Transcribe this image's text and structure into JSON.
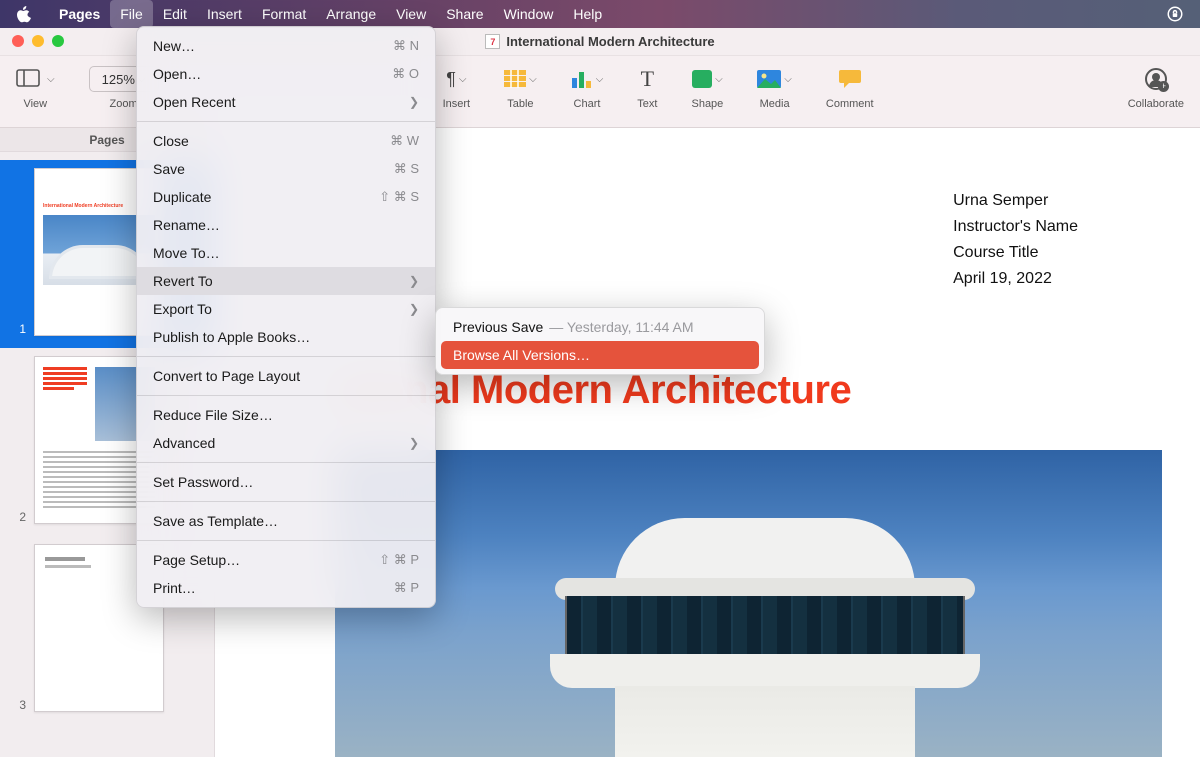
{
  "system_menubar": {
    "app_name": "Pages",
    "items": [
      "File",
      "Edit",
      "Insert",
      "Format",
      "Arrange",
      "View",
      "Share",
      "Window",
      "Help"
    ],
    "active_index": 0
  },
  "window": {
    "document_title": "International Modern Architecture",
    "doc_icon_glyph": "7"
  },
  "toolbar": {
    "view_label": "View",
    "zoom_label": "Zoom",
    "zoom_value": "125%",
    "insert_label": "Insert",
    "table_label": "Table",
    "chart_label": "Chart",
    "text_label": "Text",
    "shape_label": "Shape",
    "media_label": "Media",
    "comment_label": "Comment",
    "collaborate_label": "Collaborate"
  },
  "sidebar": {
    "heading": "Pages",
    "pages": [
      "1",
      "2",
      "3"
    ],
    "selected_index": 0
  },
  "document": {
    "meta": {
      "author": "Urna Semper",
      "instructor": "Instructor's Name",
      "course": "Course Title",
      "date": "April 19, 2022"
    },
    "title_visible": "ational Modern Architecture"
  },
  "file_menu": {
    "items": [
      {
        "label": "New…",
        "shortcut": "⌘ N"
      },
      {
        "label": "Open…",
        "shortcut": "⌘ O"
      },
      {
        "label": "Open Recent",
        "submenu": true
      },
      {
        "sep": true
      },
      {
        "label": "Close",
        "shortcut": "⌘ W"
      },
      {
        "label": "Save",
        "shortcut": "⌘ S"
      },
      {
        "label": "Duplicate",
        "shortcut": "⇧ ⌘ S"
      },
      {
        "label": "Rename…"
      },
      {
        "label": "Move To…"
      },
      {
        "label": "Revert To",
        "submenu": true,
        "hover": true
      },
      {
        "label": "Export To",
        "submenu": true
      },
      {
        "label": "Publish to Apple Books…"
      },
      {
        "sep": true
      },
      {
        "label": "Convert to Page Layout"
      },
      {
        "sep": true
      },
      {
        "label": "Reduce File Size…"
      },
      {
        "label": "Advanced",
        "submenu": true
      },
      {
        "sep": true
      },
      {
        "label": "Set Password…"
      },
      {
        "sep": true
      },
      {
        "label": "Save as Template…"
      },
      {
        "sep": true
      },
      {
        "label": "Page Setup…",
        "shortcut": "⇧ ⌘ P"
      },
      {
        "label": "Print…",
        "shortcut": "⌘ P"
      }
    ]
  },
  "revert_submenu": {
    "previous_label": "Previous Save",
    "previous_meta": "— Yesterday, 11:44 AM",
    "browse_label": "Browse All Versions…"
  }
}
